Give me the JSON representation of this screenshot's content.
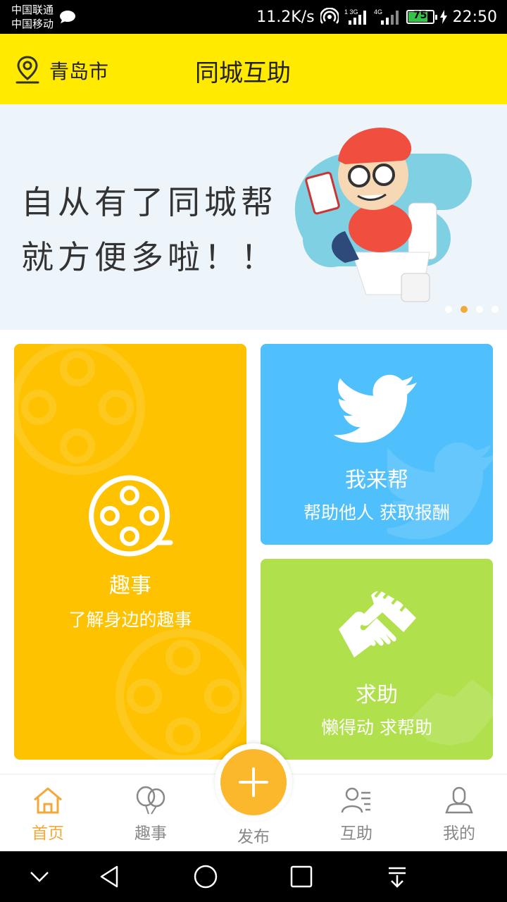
{
  "status_bar": {
    "carrier1": "中国联通",
    "carrier2": "中国移动",
    "net_speed": "11.2K/s",
    "sim1_tag": "1 3G",
    "sim2_tag": "4G",
    "battery_level": "75",
    "time": "22:50"
  },
  "header": {
    "city": "青岛市",
    "title": "同城互助"
  },
  "banner": {
    "line1": "自从有了同城帮",
    "line2": "就方便多啦！！",
    "dots_count": 4,
    "active_dot": 1
  },
  "cards": {
    "fun": {
      "title": "趣事",
      "subtitle": "了解身边的趣事",
      "color": "#fec200"
    },
    "help": {
      "title": "我来帮",
      "subtitle": "帮助他人  获取报酬",
      "color": "#4fc0fb"
    },
    "ask": {
      "title": "求助",
      "subtitle": "懒得动  求帮助",
      "color": "#b0e04c"
    }
  },
  "bottom_nav": {
    "items": [
      {
        "label": "首页",
        "icon": "home-icon",
        "active": true
      },
      {
        "label": "趣事",
        "icon": "balloons-icon",
        "active": false
      },
      {
        "label": "发布",
        "icon": "plus-icon",
        "active": false
      },
      {
        "label": "互助",
        "icon": "contacts-icon",
        "active": false
      },
      {
        "label": "我的",
        "icon": "user-icon",
        "active": false
      }
    ],
    "accent": "#f3a83a"
  },
  "theme": {
    "header_bg": "#ffea00",
    "fab_color": "#fbb82d"
  }
}
